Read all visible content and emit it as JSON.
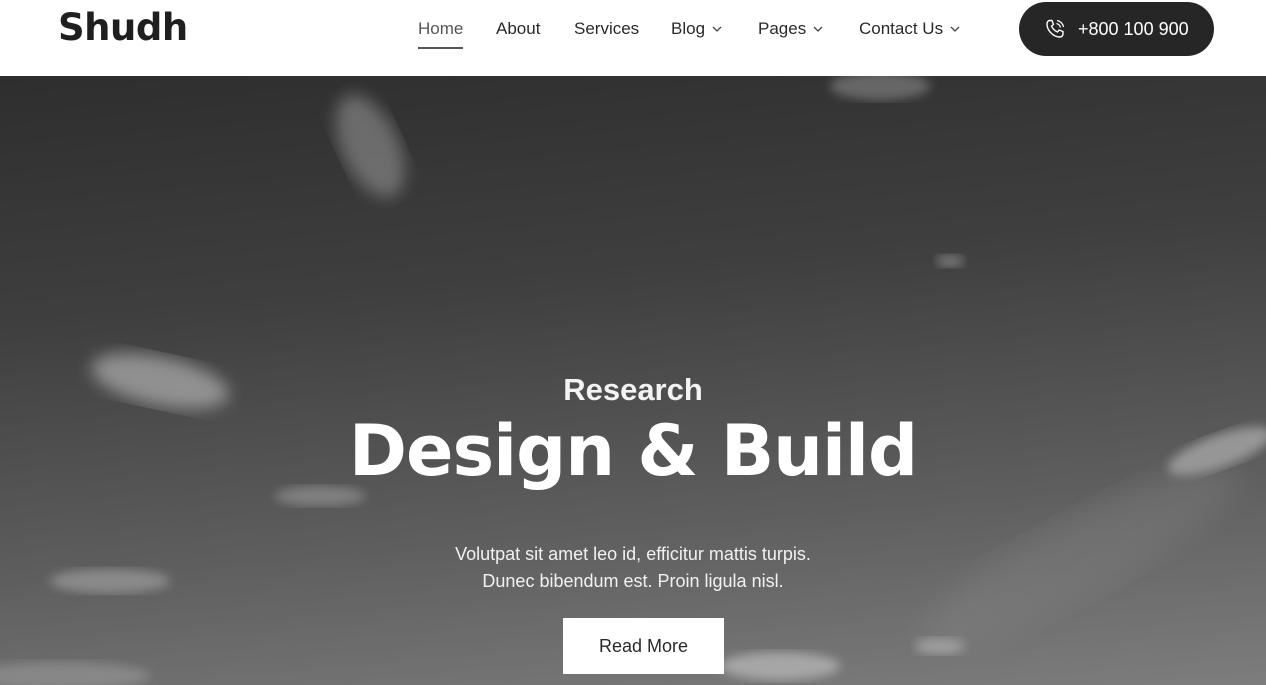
{
  "brand": {
    "name": "Shudh"
  },
  "nav": {
    "items": [
      {
        "label": "Home",
        "active": true,
        "dropdown": false
      },
      {
        "label": "About",
        "active": false,
        "dropdown": false
      },
      {
        "label": "Services",
        "active": false,
        "dropdown": false
      },
      {
        "label": "Blog",
        "active": false,
        "dropdown": true
      },
      {
        "label": "Pages",
        "active": false,
        "dropdown": true
      },
      {
        "label": "Contact Us",
        "active": false,
        "dropdown": true
      }
    ]
  },
  "phone": {
    "label": "+800 100 900",
    "icon": "phone-icon"
  },
  "hero": {
    "kicker": "Research",
    "title": "Design & Build",
    "text_line1": "Volutpat sit amet leo id, efficitur mattis turpis.",
    "text_line2": "Dunec bibendum est. Proin ligula nisl.",
    "button_label": "Read More"
  },
  "colors": {
    "header_bg": "#ffffff",
    "phone_button_bg": "#262626",
    "hero_overlay": "#3f3f3f"
  }
}
